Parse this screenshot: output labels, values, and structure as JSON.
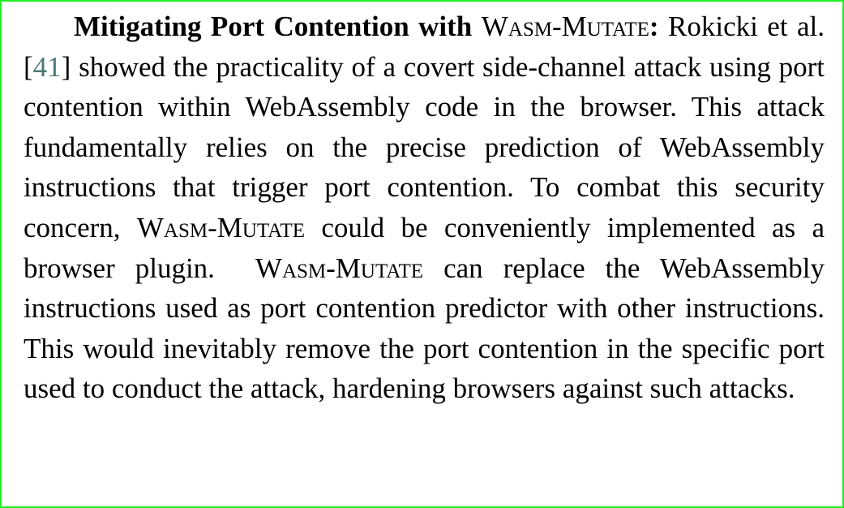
{
  "paragraph": {
    "heading_bold": "Mitigating Port Contention with",
    "heading_tool": "Wasm-Mutate",
    "heading_colon": ":",
    "seg1": "Rokicki et al. [",
    "cite": "41",
    "seg2": "] showed the practicality of a covert side-channel attack using port contention within WebAssembly code in the browser. This attack fundamentally relies on the precise prediction of WebAssembly instructions that trigger port contention.  To combat this security concern,",
    "tool_1": "Wasm-Mutate",
    "seg3": "could be conveniently implemented as a browser plugin.",
    "tool_2": "Wasm-Mutate",
    "seg4": "can replace the WebAssembly instructions used as port contention predictor with other instructions.  This would inevitably remove the port contention in the specific port used to conduct the attack, hardening browsers against such attacks."
  },
  "colors": {
    "border": "#22ee22",
    "citation": "#4a7a76",
    "text": "#000000"
  }
}
